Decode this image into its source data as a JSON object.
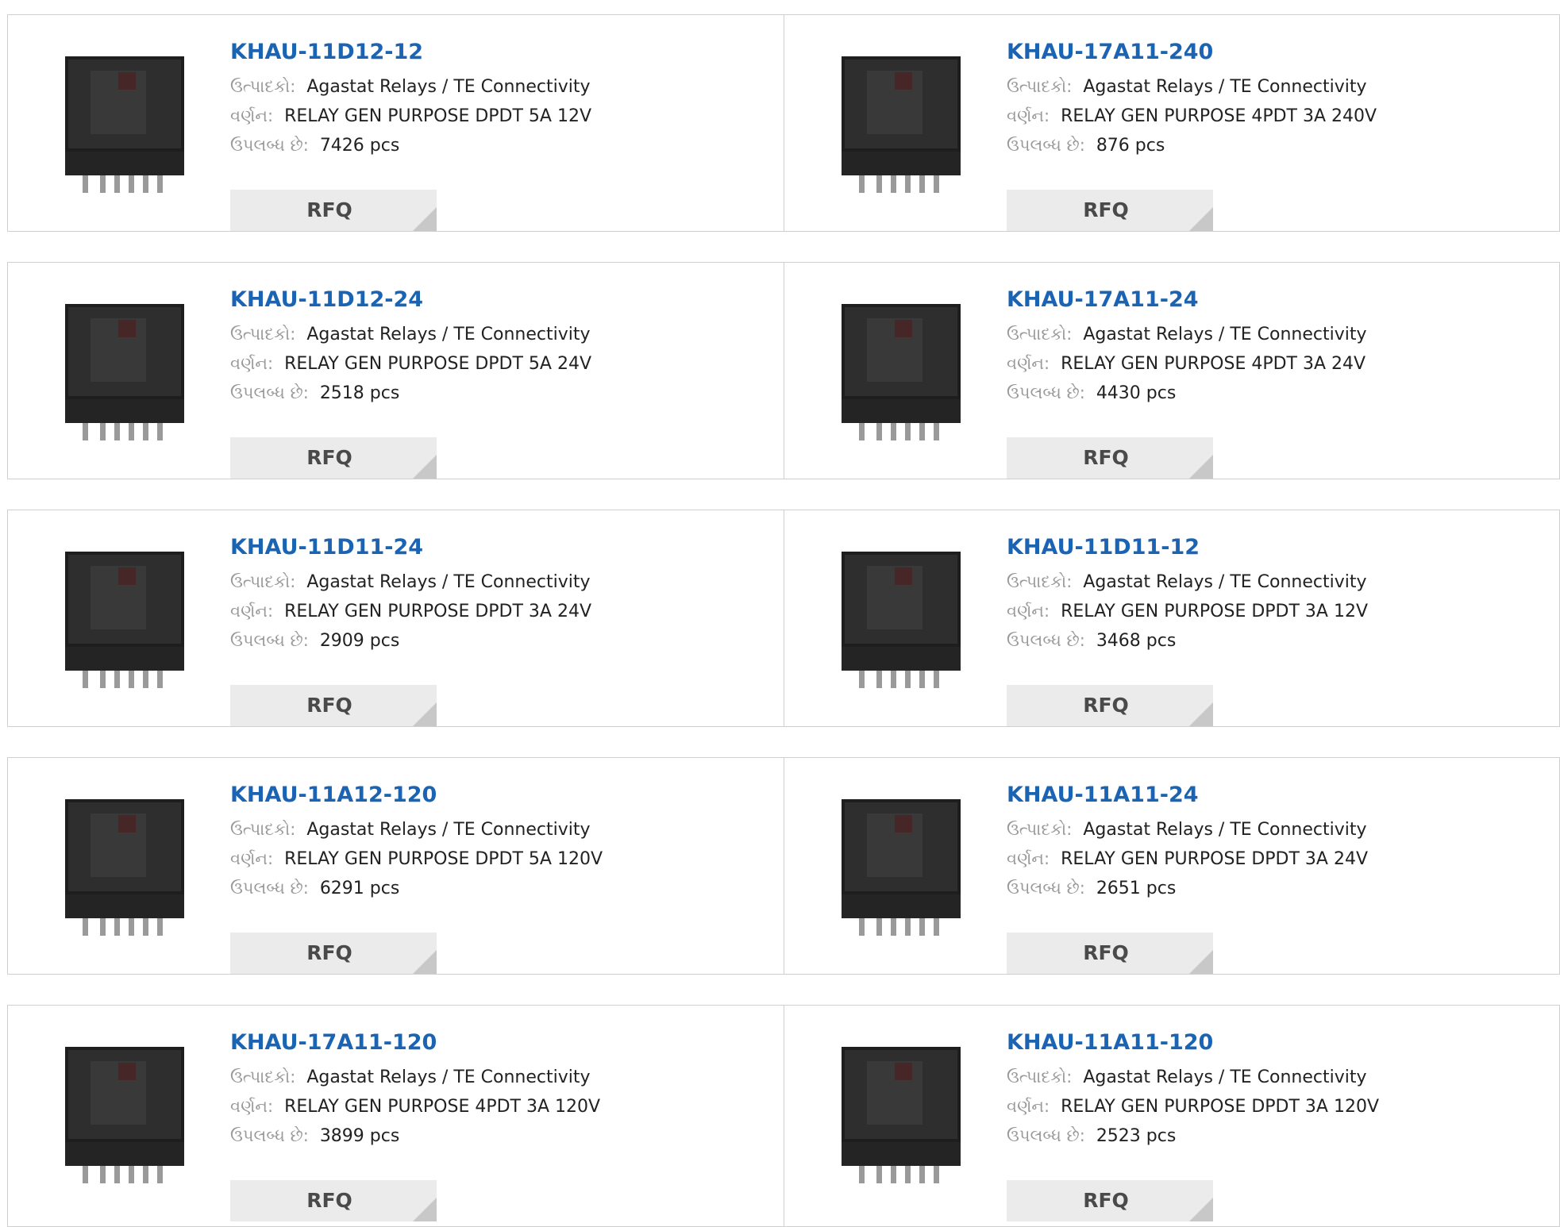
{
  "labels": {
    "manufacturer": "ઉત્પાદકો:",
    "description": "વર્ણન:",
    "available": "ઉપલબ્ધ છે:"
  },
  "colors": {
    "title": "#1a64b3",
    "border": "#cfcfcf",
    "rfq_bg": "#ebebeb",
    "rfq_corner": "#c8c8c8"
  },
  "products": [
    {
      "part": "KHAU-11D12-12",
      "manufacturer": "Agastat Relays / TE Connectivity",
      "description": "RELAY GEN PURPOSE DPDT 5A 12V",
      "available": "7426 pcs",
      "rfq": "RFQ"
    },
    {
      "part": "KHAU-17A11-240",
      "manufacturer": "Agastat Relays / TE Connectivity",
      "description": "RELAY GEN PURPOSE 4PDT 3A 240V",
      "available": "876 pcs",
      "rfq": "RFQ"
    },
    {
      "part": "KHAU-11D12-24",
      "manufacturer": "Agastat Relays / TE Connectivity",
      "description": "RELAY GEN PURPOSE DPDT 5A 24V",
      "available": "2518 pcs",
      "rfq": "RFQ"
    },
    {
      "part": "KHAU-17A11-24",
      "manufacturer": "Agastat Relays / TE Connectivity",
      "description": "RELAY GEN PURPOSE 4PDT 3A 24V",
      "available": "4430 pcs",
      "rfq": "RFQ"
    },
    {
      "part": "KHAU-11D11-24",
      "manufacturer": "Agastat Relays / TE Connectivity",
      "description": "RELAY GEN PURPOSE DPDT 3A 24V",
      "available": "2909 pcs",
      "rfq": "RFQ"
    },
    {
      "part": "KHAU-11D11-12",
      "manufacturer": "Agastat Relays / TE Connectivity",
      "description": "RELAY GEN PURPOSE DPDT 3A 12V",
      "available": "3468 pcs",
      "rfq": "RFQ"
    },
    {
      "part": "KHAU-11A12-120",
      "manufacturer": "Agastat Relays / TE Connectivity",
      "description": "RELAY GEN PURPOSE DPDT 5A 120V",
      "available": "6291 pcs",
      "rfq": "RFQ"
    },
    {
      "part": "KHAU-11A11-24",
      "manufacturer": "Agastat Relays / TE Connectivity",
      "description": "RELAY GEN PURPOSE DPDT 3A 24V",
      "available": "2651 pcs",
      "rfq": "RFQ"
    },
    {
      "part": "KHAU-17A11-120",
      "manufacturer": "Agastat Relays / TE Connectivity",
      "description": "RELAY GEN PURPOSE 4PDT 3A 120V",
      "available": "3899 pcs",
      "rfq": "RFQ"
    },
    {
      "part": "KHAU-11A11-120",
      "manufacturer": "Agastat Relays / TE Connectivity",
      "description": "RELAY GEN PURPOSE DPDT 3A 120V",
      "available": "2523 pcs",
      "rfq": "RFQ"
    }
  ]
}
